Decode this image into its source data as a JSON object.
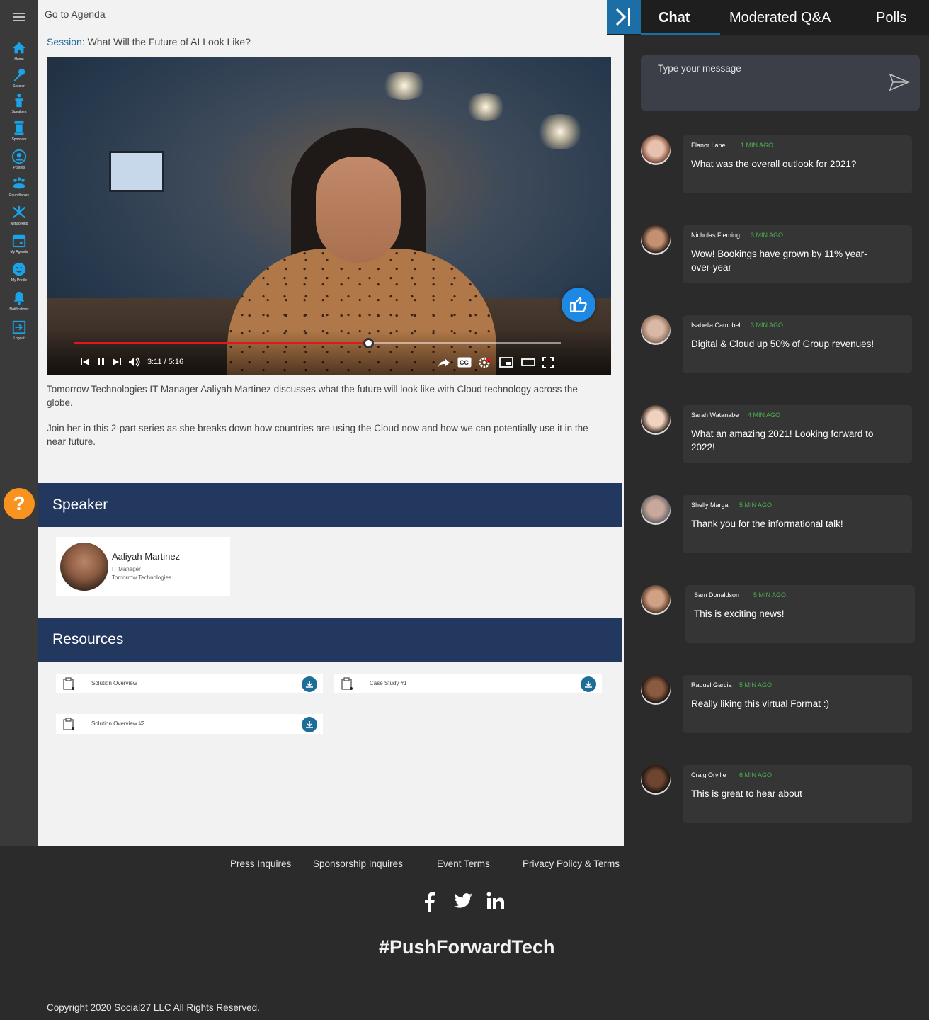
{
  "nav": {
    "items": [
      {
        "label": "Home",
        "icon": "home-icon"
      },
      {
        "label": "Session",
        "icon": "microphone-icon"
      },
      {
        "label": "Speakers",
        "icon": "podium-icon"
      },
      {
        "label": "Sponsors",
        "icon": "banner-icon"
      },
      {
        "label": "Posters",
        "icon": "user-circle-icon"
      },
      {
        "label": "Roundtables",
        "icon": "group-icon"
      },
      {
        "label": "Networking",
        "icon": "network-icon"
      },
      {
        "label": "My Agenda",
        "icon": "calendar-icon"
      },
      {
        "label": "My Profile",
        "icon": "smiley-icon"
      },
      {
        "label": "Notifications",
        "icon": "bell-icon"
      },
      {
        "label": "Logout",
        "icon": "logout-icon"
      }
    ]
  },
  "header": {
    "goto_agenda": "Go to Agenda",
    "session_key": "Session:",
    "session_title": "What Will the Future of AI Look Like?"
  },
  "video": {
    "time": "3:11 / 5:16",
    "progress": 0.604
  },
  "description": {
    "p1": "Tomorrow Technologies IT Manager Aaliyah Martinez discusses what the future will look like with Cloud technology across the globe.",
    "p2": "Join her in this 2-part series as she breaks down how countries are using the Cloud now and how we can potentially use it in the near future."
  },
  "speaker": {
    "section_title": "Speaker",
    "name": "Aaliyah Martinez",
    "title": "IT Manager",
    "company": "Tomorrow Technologies"
  },
  "resources": {
    "section_title": "Resources",
    "items": [
      {
        "label": "Solution Overview"
      },
      {
        "label": "Case Study #1"
      },
      {
        "label": "Solution Overview #2"
      }
    ]
  },
  "help": {
    "label": "?"
  },
  "footer": {
    "links": [
      "Press Inquires",
      "Sponsorship Inquires",
      "Event Terms",
      "Privacy Policy & Terms"
    ],
    "hashtag": "#PushForwardTech",
    "copyright": "Copyright 2020 Social27 LLC All Rights Reserved."
  },
  "panel": {
    "tabs": [
      "Chat",
      "Moderated Q&A",
      "Polls"
    ],
    "active_tab": "Chat",
    "input_placeholder": "Type your message",
    "accent_color": "#1c6fa6",
    "time_color": "#4caf50"
  },
  "chat": {
    "messages": [
      {
        "author": "Elanor Lane",
        "ago": "1 MIN AGO",
        "text": "What was the overall outlook for 2021?"
      },
      {
        "author": "Nicholas Fleming",
        "ago": "3 MIN AGO",
        "text": "Wow! Bookings have grown by 11% year-over-year"
      },
      {
        "author": "Isabella Campbell",
        "ago": "3 MIN AGO",
        "text": "Digital & Cloud up 50% of Group revenues!"
      },
      {
        "author": "Sarah Watanabe",
        "ago": "4 MIN AGO",
        "text": "What an amazing 2021! Looking forward to 2022!"
      },
      {
        "author": "Shelly Marga",
        "ago": "5 MIN AGO",
        "text": "Thank you for the informational talk!"
      },
      {
        "author": "Sam Donaldson",
        "ago": "5 MIN AGO",
        "text": "This is exciting news!"
      },
      {
        "author": "Raquel Garcia",
        "ago": "5 MIN AGO",
        "text": "Really liking this virtual Format :)"
      },
      {
        "author": "Craig Orville",
        "ago": "6 MIN AGO",
        "text": "This is great to hear about"
      }
    ]
  }
}
